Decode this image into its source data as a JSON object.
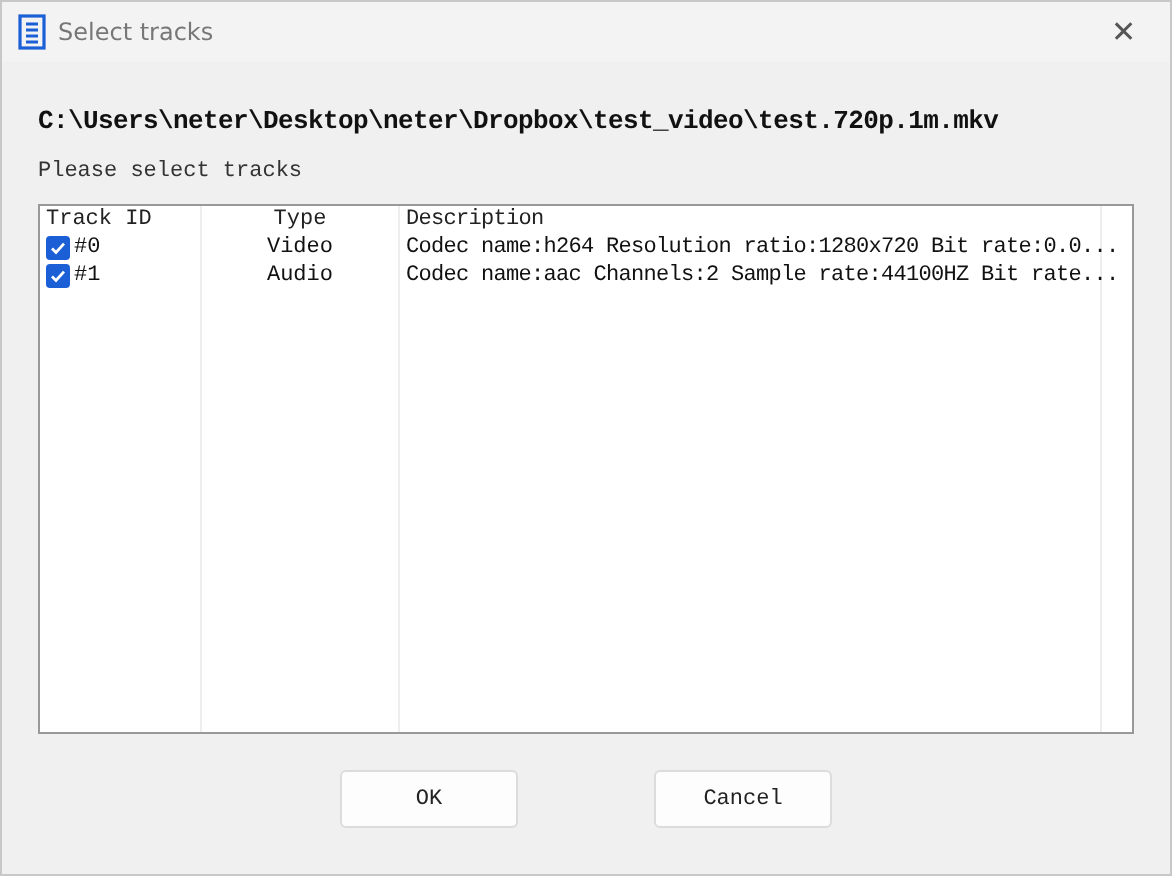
{
  "window": {
    "title": "Select tracks",
    "close": "✕"
  },
  "path": "C:\\Users\\neter\\Desktop\\neter\\Dropbox\\test_video\\test.720p.1m.mkv",
  "prompt": "Please select tracks",
  "table": {
    "columns": [
      "Track ID",
      "Type",
      "Description"
    ],
    "rows": [
      {
        "checked": true,
        "id": "#0",
        "type": "Video",
        "description": "Codec name:h264 Resolution ratio:1280x720 Bit rate:0.0..."
      },
      {
        "checked": true,
        "id": "#1",
        "type": "Audio",
        "description": "Codec name:aac Channels:2 Sample rate:44100HZ Bit rate..."
      }
    ]
  },
  "buttons": [
    "OK",
    "Cancel"
  ]
}
